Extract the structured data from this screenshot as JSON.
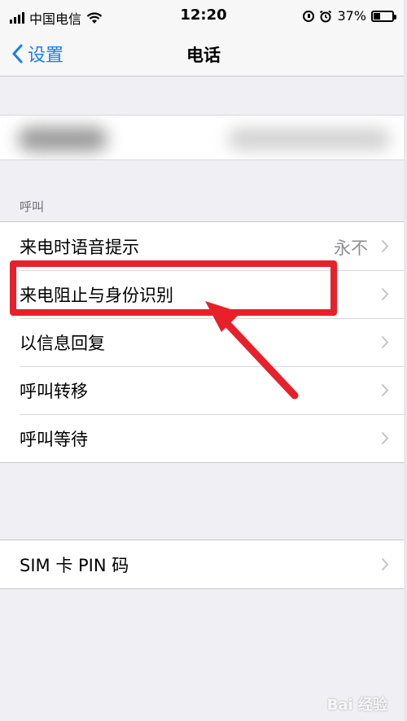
{
  "status_bar": {
    "carrier": "中国电信",
    "time": "12:20",
    "battery": "37%",
    "battery_level": 0.37,
    "icons": [
      "signal-icon",
      "wifi-icon",
      "orientation-lock-icon",
      "alarm-icon",
      "battery-icon"
    ]
  },
  "nav": {
    "back_label": "设置",
    "title": "电话"
  },
  "section": {
    "header": "呼叫"
  },
  "calls_group": {
    "items": [
      {
        "label": "来电时语音提示",
        "value": "永不"
      },
      {
        "label": "来电阻止与身份识别",
        "value": ""
      },
      {
        "label": "以信息回复",
        "value": ""
      },
      {
        "label": "呼叫转移",
        "value": ""
      },
      {
        "label": "呼叫等待",
        "value": ""
      }
    ]
  },
  "sim_group": {
    "items": [
      {
        "label": "SIM 卡 PIN 码"
      }
    ]
  },
  "annotation": {
    "color": "#e8202a"
  },
  "watermark": {
    "text": "Bai 经验"
  },
  "colors": {
    "accent": "#1a7cf5",
    "background": "#efeff4",
    "secondary_text": "#8e8e93"
  }
}
